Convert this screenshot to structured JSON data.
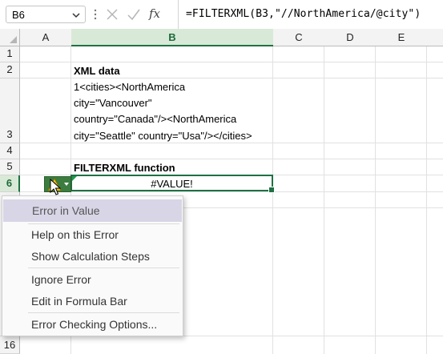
{
  "formula_bar": {
    "name_box": "B6",
    "fx_label": "fx",
    "formula": "=FILTERXML(B3,\"//NorthAmerica/@city\")"
  },
  "columns": [
    "A",
    "B",
    "C",
    "D",
    "E"
  ],
  "rows": [
    "1",
    "2",
    "3",
    "4",
    "5",
    "6",
    "16"
  ],
  "cells": {
    "b2": "XML data",
    "b3_lines": [
      "1<cities><NorthAmerica",
      "city=\"Vancouver\"",
      "country=\"Canada\"/><NorthAmerica",
      "city=\"Seattle\" country=\"Usa\"/></cities>"
    ],
    "b5": "FILTERXML function",
    "b6": "#VALUE!"
  },
  "menu": {
    "header": "Error in Value",
    "items": [
      "Help on this Error",
      "Show Calculation Steps",
      "Ignore Error",
      "Edit in Formula Bar",
      "Error Checking Options..."
    ]
  },
  "colors": {
    "accent_green": "#1e7145",
    "menu_highlight": "#d8d5e6"
  }
}
